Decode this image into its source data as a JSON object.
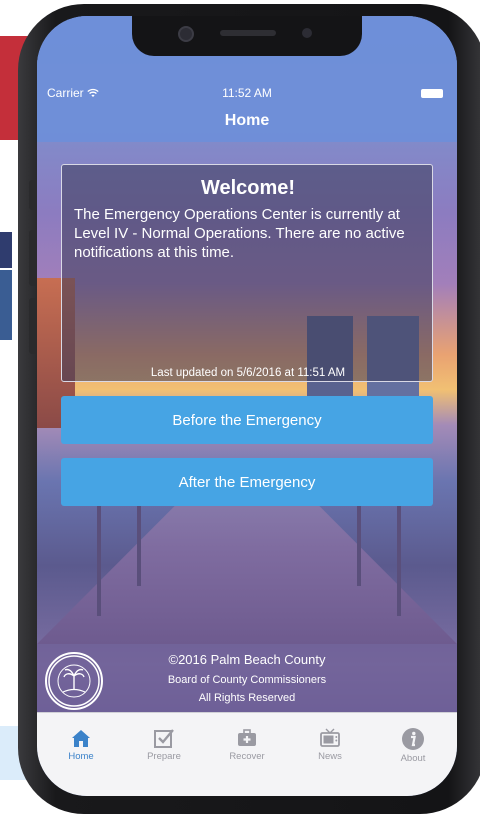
{
  "status_bar": {
    "carrier": "Carrier",
    "time": "11:52 AM"
  },
  "nav": {
    "title": "Home"
  },
  "welcome": {
    "title": "Welcome!",
    "message": "The Emergency Operations Center is currently at Level IV - Normal Operations. There are no active notifications at this time.",
    "last_updated": "Last updated on 5/6/2016 at 11:51 AM"
  },
  "buttons": {
    "before": "Before the Emergency",
    "after": "After the Emergency"
  },
  "footer": {
    "copyright": "©2016 Palm Beach County",
    "board": "Board of County Commissioners",
    "rights": "All Rights Reserved",
    "seal_top": "PALM BEACH COUNTY",
    "seal_bottom": "FLORIDA"
  },
  "tabs": [
    {
      "label": "Home",
      "icon": "home-icon",
      "active": true
    },
    {
      "label": "Prepare",
      "icon": "checkbox-icon",
      "active": false
    },
    {
      "label": "Recover",
      "icon": "first-aid-kit-icon",
      "active": false
    },
    {
      "label": "News",
      "icon": "tv-icon",
      "active": false
    },
    {
      "label": "About",
      "icon": "info-icon",
      "active": false
    }
  ],
  "colors": {
    "button": "#46a4e4",
    "nav_bar": "#6e8fd8",
    "tab_active": "#3b82c9",
    "tab_inactive": "#9a9aa2"
  }
}
